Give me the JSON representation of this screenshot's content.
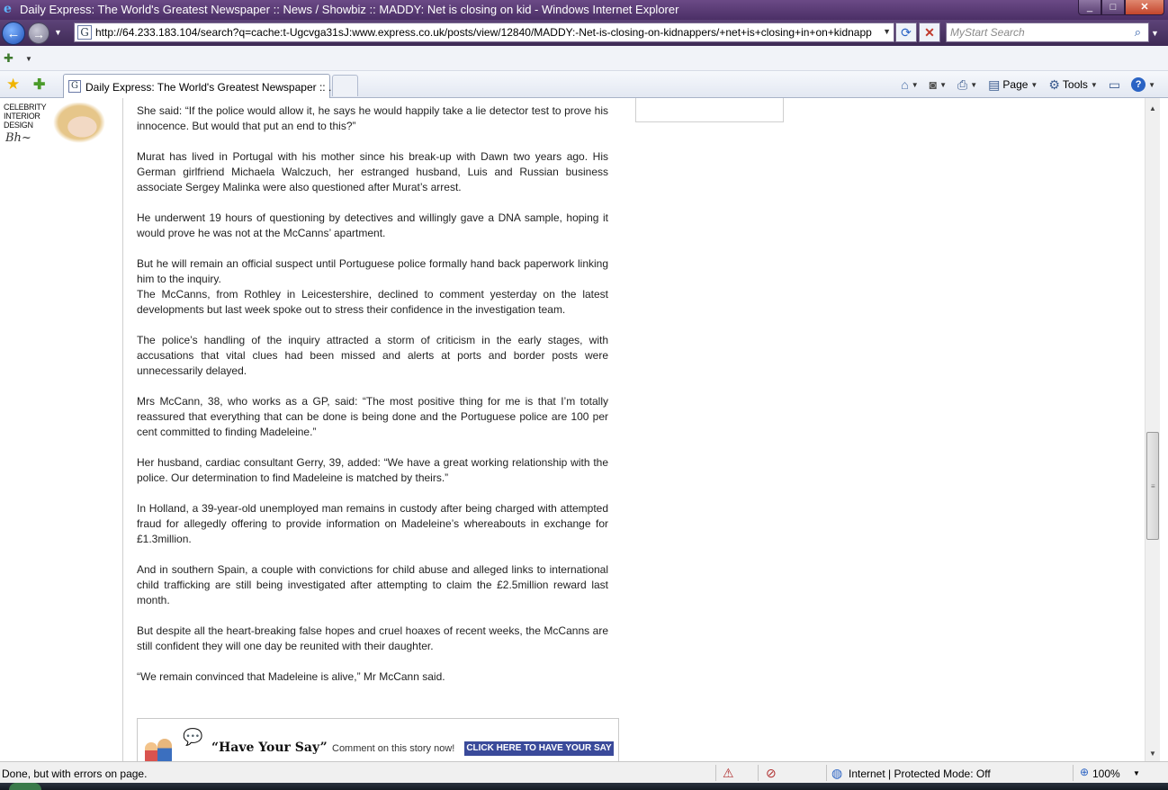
{
  "window": {
    "title": "Daily Express: The World's Greatest Newspaper :: News / Showbiz :: MADDY: Net is closing on kid - Windows Internet Explorer",
    "controls": {
      "minimize": "_",
      "maximize": "□",
      "close": "✕"
    }
  },
  "navigation": {
    "url": "http://64.233.183.104/search?q=cache:t-Ugcvga31sJ:www.express.co.uk/posts/view/12840/MADDY:-Net-is-closing-on-kidnappers/+net+is+closing+in+on+kidnapp",
    "search_placeholder": "MyStart Search"
  },
  "tabs": [
    {
      "label": "Daily Express: The World's Greatest Newspaper :: ..."
    }
  ],
  "toolbar": {
    "page_label": "Page",
    "tools_label": "Tools"
  },
  "sidebar_ad": {
    "text_line1": "CELEBRITY",
    "text_line2": "INTERIOR",
    "text_line3": "DESIGN"
  },
  "article": {
    "paragraphs": [
      "She said: “If the police would allow it, he says he would happily take a lie detector test to prove his innocence. But would that put an end to this?”",
      "Murat has lived in Portugal with his mother since his break-up with Dawn two years ago. His German girlfriend Michaela Walczuch, her estranged husband, Luis and Russian business associate Sergey Malinka were also questioned after Murat’s arrest.",
      "He underwent 19 hours of questioning by detectives and willingly gave a DNA sample, hoping it would prove he was not at the McCanns’ apartment.",
      "But he will remain an official suspect until Portuguese police formally hand back paperwork linking him to the inquiry.",
      "The McCanns, from Rothley in Leicestershire, declined to comment yesterday on the latest developments but last week spoke out to stress their confidence in the investigation team.",
      "The police’s handling of the inquiry attracted a storm of criticism in the early stages, with accusations that vital clues had been missed and alerts at ports and border posts were unnecessarily delayed.",
      "Mrs McCann, 38, who works as a GP, said: “The most positive thing for me is that I’m totally reassured that everything that can be done is being done and the Portuguese police are 100 per cent committed to finding Madeleine.”",
      "Her husband, cardiac consultant Gerry, 39, added: “We have a great working relationship with the police. Our determination to find Madeleine is matched by theirs.”",
      "In Holland, a 39-year-old unemployed man remains in custody after being charged with attempted fraud for allegedly offering to provide information on Madeleine’s whereabouts in exchange for £1.3million.",
      "And in southern Spain, a couple with convictions for child abuse and alleged links to international child trafficking are still being investigated after attempting to claim the £2.5million reward last month.",
      "But despite all the heart-breaking false hopes and cruel hoaxes of recent weeks, the McCanns are still confident they will one day be reunited with their daughter.",
      "“We remain convinced that Madeleine is alive,” Mr McCann said."
    ]
  },
  "have_your_say": {
    "title": "“Have Your Say”",
    "subtitle": "Comment on this story now!",
    "button": "CLICK HERE TO HAVE YOUR SAY"
  },
  "statusbar": {
    "status_text": "Done, but with errors on page.",
    "zone": "Internet | Protected Mode: Off",
    "zoom": "100%"
  }
}
